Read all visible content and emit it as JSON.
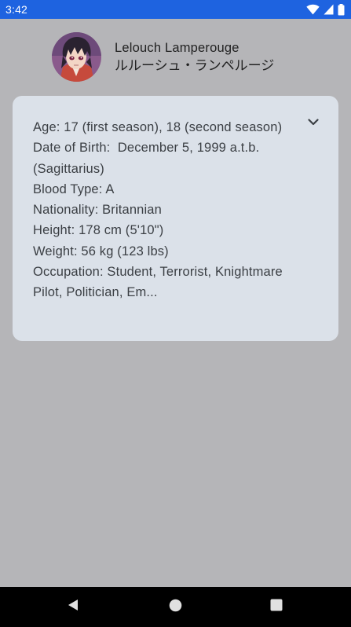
{
  "status_bar": {
    "time": "3:42",
    "icons": [
      "wifi-icon",
      "signal-icon",
      "battery-icon"
    ]
  },
  "header": {
    "name_en": "Lelouch Lamperouge",
    "name_jp": "ルルーシュ・ランペルージ",
    "avatar": "character-avatar"
  },
  "details_card": {
    "expand_icon": "chevron-down-icon",
    "lines": [
      "Age: 17 (first season), 18 (second season)",
      "Date of Birth:  December 5, 1999 a.t.b. (Sagittarius)",
      "Blood Type: A",
      "Nationality: Britannian",
      "Height: 178 cm (5'10\")",
      "Weight: 56 kg (123 lbs)",
      "Occupation: Student, Terrorist, Knightmare Pilot, Politician, Em..."
    ]
  },
  "nav_bar": {
    "buttons": [
      "back-icon",
      "home-icon",
      "recents-icon"
    ]
  },
  "colors": {
    "status_bar": "#1e63e0",
    "background": "#b5b5b8",
    "card": "#dbe1e9",
    "nav_bar": "#000000"
  }
}
